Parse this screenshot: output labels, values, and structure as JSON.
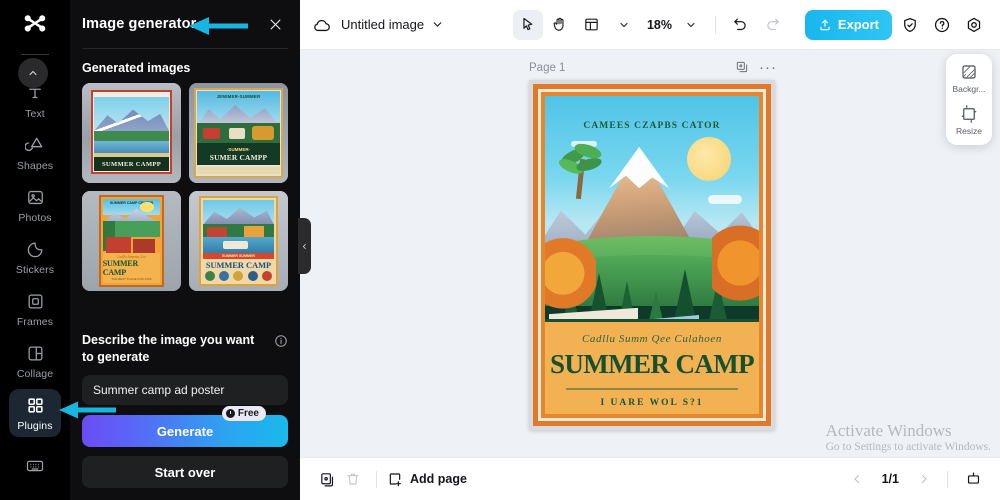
{
  "rail": {
    "logo_icon": "capcut-logo",
    "items": [
      {
        "label": "Text",
        "icon": "text-icon"
      },
      {
        "label": "Shapes",
        "icon": "shapes-icon"
      },
      {
        "label": "Photos",
        "icon": "photos-icon"
      },
      {
        "label": "Stickers",
        "icon": "stickers-icon"
      },
      {
        "label": "Frames",
        "icon": "frames-icon"
      },
      {
        "label": "Collage",
        "icon": "collage-icon"
      },
      {
        "label": "Plugins",
        "icon": "plugins-icon"
      }
    ],
    "active_item": "Plugins",
    "bottom_icon": "keyboard-icon",
    "scroll_up_icon": "chevron-up-icon"
  },
  "panel": {
    "title": "Image generator",
    "close_icon": "close-icon",
    "collapse_icon": "chevron-left-icon",
    "section_title": "Generated images",
    "thumbnails": [
      {
        "caption": "SUMMER CAMPP",
        "variant": "lake-mountains"
      },
      {
        "caption": "SUMER CAMPP",
        "headline": "JEMIMER-SUMMER",
        "variant": "vans-mountains"
      },
      {
        "caption": "SUMMER CAMP",
        "variant": "cabins-palm"
      },
      {
        "caption": "SUMMER CAMP",
        "variant": "lakeside-camp"
      }
    ],
    "describe_label": "Describe the image you want to generate",
    "info_icon": "info-icon",
    "prompt_value": "Summer camp ad poster",
    "prompt_placeholder": "Describe the image you want to generate",
    "generate_label": "Generate",
    "free_badge": "Free",
    "free_badge_icon": "clock-icon",
    "start_over_label": "Start over"
  },
  "topbar": {
    "cloud_icon": "cloud-save-icon",
    "doc_title": "Untitled image",
    "doc_caret_icon": "chevron-down-icon",
    "tools": [
      {
        "name": "select-tool",
        "icon": "cursor-icon",
        "selected": true
      },
      {
        "name": "hand-tool",
        "icon": "hand-icon",
        "selected": false
      },
      {
        "name": "layout-tool",
        "icon": "layout-icon",
        "selected": false
      }
    ],
    "layout_caret_icon": "chevron-down-icon",
    "zoom_value": "18%",
    "zoom_caret_icon": "chevron-down-icon",
    "undo_icon": "undo-icon",
    "redo_icon": "redo-icon",
    "export_label": "Export",
    "export_icon": "upload-icon",
    "right_icons": [
      {
        "name": "shield-check-icon"
      },
      {
        "name": "help-icon"
      },
      {
        "name": "settings-icon"
      }
    ]
  },
  "canvas": {
    "page_label": "Page 1",
    "duplicate_icon": "duplicate-icon",
    "more_icon": "more-horizontal-icon",
    "poster": {
      "top_headline": "CAMEES CZAPBS CATOR",
      "script_line": "Cadllu  Summ Qee  Culahoen",
      "main_title": "SUMMER CAMP",
      "sub_line": "I UARE WOL S?1"
    }
  },
  "float_panel": {
    "items": [
      {
        "label": "Backgr...",
        "icon": "background-icon"
      },
      {
        "label": "Resize",
        "icon": "resize-icon"
      }
    ]
  },
  "watermark": {
    "line1": "Activate Windows",
    "line2": "Go to Settings to activate Windows."
  },
  "bottombar": {
    "duplicate_icon": "duplicate-page-icon",
    "delete_icon": "trash-icon",
    "add_page_label": "Add page",
    "add_page_icon": "add-page-icon",
    "prev_icon": "chevron-left-icon",
    "page_indicator": "1/1",
    "next_icon": "chevron-right-icon",
    "present_icon": "present-icon"
  },
  "annotations": {
    "arrow_color": "#17b6e0",
    "arrows": [
      {
        "name": "arrow-to-panel-title",
        "target": "Image generator"
      },
      {
        "name": "arrow-to-plugins",
        "target": "Plugins"
      }
    ]
  },
  "colors": {
    "rail_bg": "#000000",
    "panel_bg": "#0e0e10",
    "accent": "#17b6e0",
    "export_blue": "#19b7ef",
    "generate_from": "#6b4df5",
    "generate_to": "#19b9ec",
    "canvas_bg": "#eef1f5",
    "active_item_bg": "#1c2733"
  }
}
